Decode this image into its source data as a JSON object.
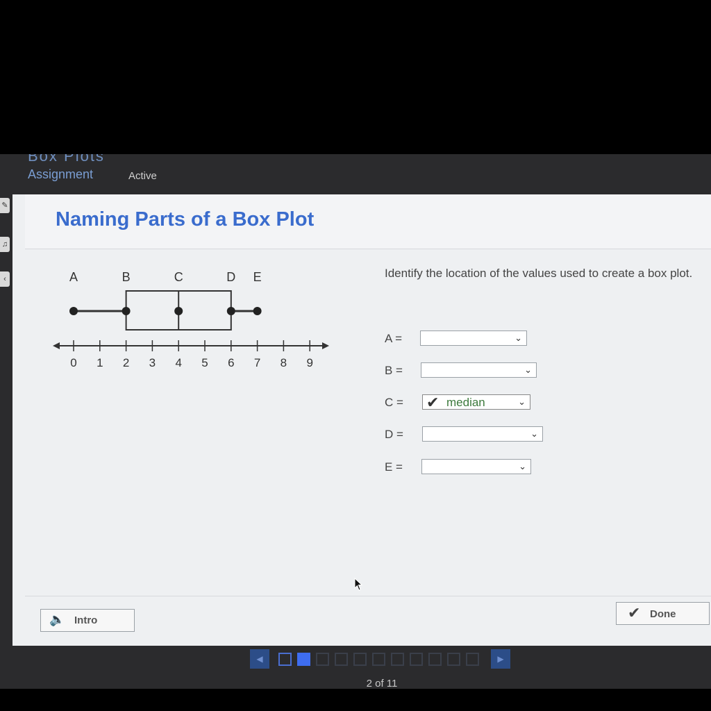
{
  "lesson": {
    "partial_title": "Box Plots"
  },
  "tabs": {
    "assignment": "Assignment",
    "status": "Active"
  },
  "panel": {
    "title": "Naming Parts of a Box Plot",
    "question": "Identify the location of the values used to create a box plot."
  },
  "box_plot": {
    "letters": [
      "A",
      "B",
      "C",
      "D",
      "E"
    ],
    "tick_labels": [
      "0",
      "1",
      "2",
      "3",
      "4",
      "5",
      "6",
      "7",
      "8",
      "9"
    ],
    "points": {
      "A": 0,
      "B": 2,
      "C": 4,
      "D": 6,
      "E": 7
    }
  },
  "answers": [
    {
      "label": "A =",
      "value": "",
      "correct": false
    },
    {
      "label": "B =",
      "value": "",
      "correct": false
    },
    {
      "label": "C =",
      "value": "median",
      "correct": true
    },
    {
      "label": "D =",
      "value": "",
      "correct": false
    },
    {
      "label": "E =",
      "value": "",
      "correct": false
    }
  ],
  "footer": {
    "intro": "Intro",
    "done": "Done"
  },
  "pager": {
    "current": 2,
    "total": 11,
    "text": "2 of 11"
  },
  "colors": {
    "title": "#3a6ccd",
    "accent": "#3e6df0",
    "correct_text": "#3c7a3c"
  }
}
